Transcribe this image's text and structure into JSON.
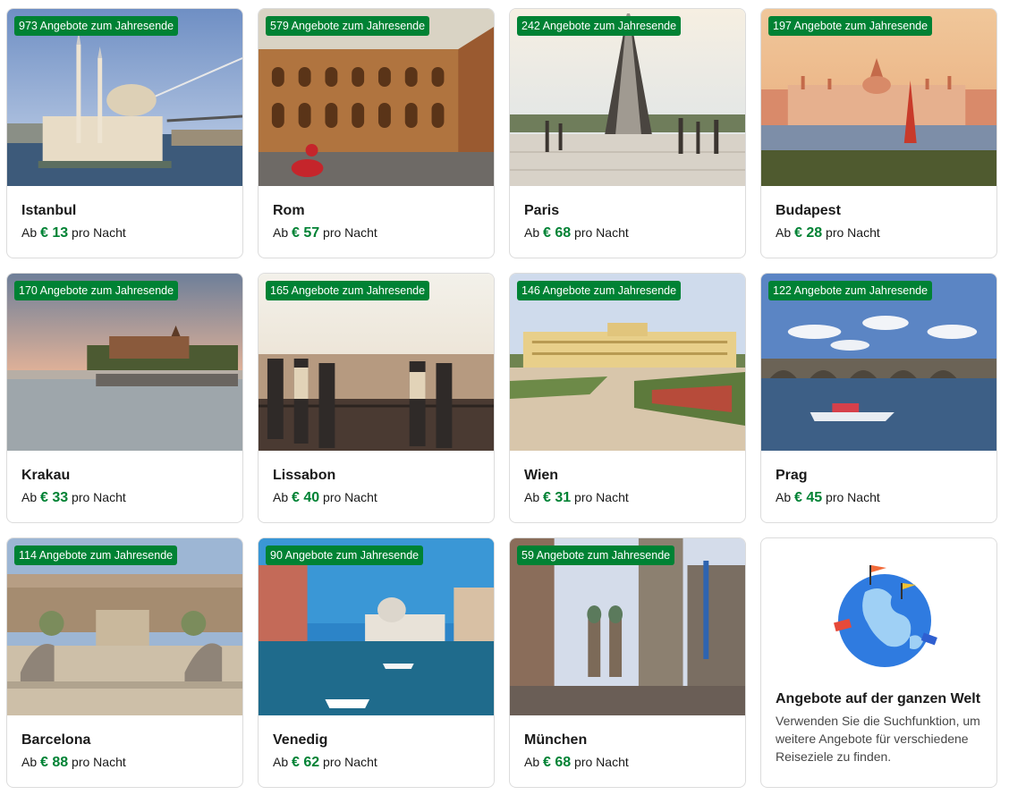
{
  "prefix": "Ab",
  "suffix": "pro Nacht",
  "cards": [
    {
      "city": "Istanbul",
      "badge": "973 Angebote zum Jahresende",
      "price": "€ 13"
    },
    {
      "city": "Rom",
      "badge": "579 Angebote zum Jahresende",
      "price": "€ 57"
    },
    {
      "city": "Paris",
      "badge": "242 Angebote zum Jahresende",
      "price": "€ 68"
    },
    {
      "city": "Budapest",
      "badge": "197 Angebote zum Jahresende",
      "price": "€ 28"
    },
    {
      "city": "Krakau",
      "badge": "170 Angebote zum Jahresende",
      "price": "€ 33"
    },
    {
      "city": "Lissabon",
      "badge": "165 Angebote zum Jahresende",
      "price": "€ 40"
    },
    {
      "city": "Wien",
      "badge": "146 Angebote zum Jahresende",
      "price": "€ 31"
    },
    {
      "city": "Prag",
      "badge": "122 Angebote zum Jahresende",
      "price": "€ 45"
    },
    {
      "city": "Barcelona",
      "badge": "114 Angebote zum Jahresende",
      "price": "€ 88"
    },
    {
      "city": "Venedig",
      "badge": "90 Angebote zum Jahresende",
      "price": "€ 62"
    },
    {
      "city": "München",
      "badge": "59 Angebote zum Jahresende",
      "price": "€ 68"
    }
  ],
  "world": {
    "title": "Angebote auf der ganzen Welt",
    "description": "Verwenden Sie die Suchfunktion, um weitere Angebote für verschiedene Reiseziele zu finden."
  },
  "colors": {
    "badge_bg": "#008234",
    "price": "#008234"
  }
}
